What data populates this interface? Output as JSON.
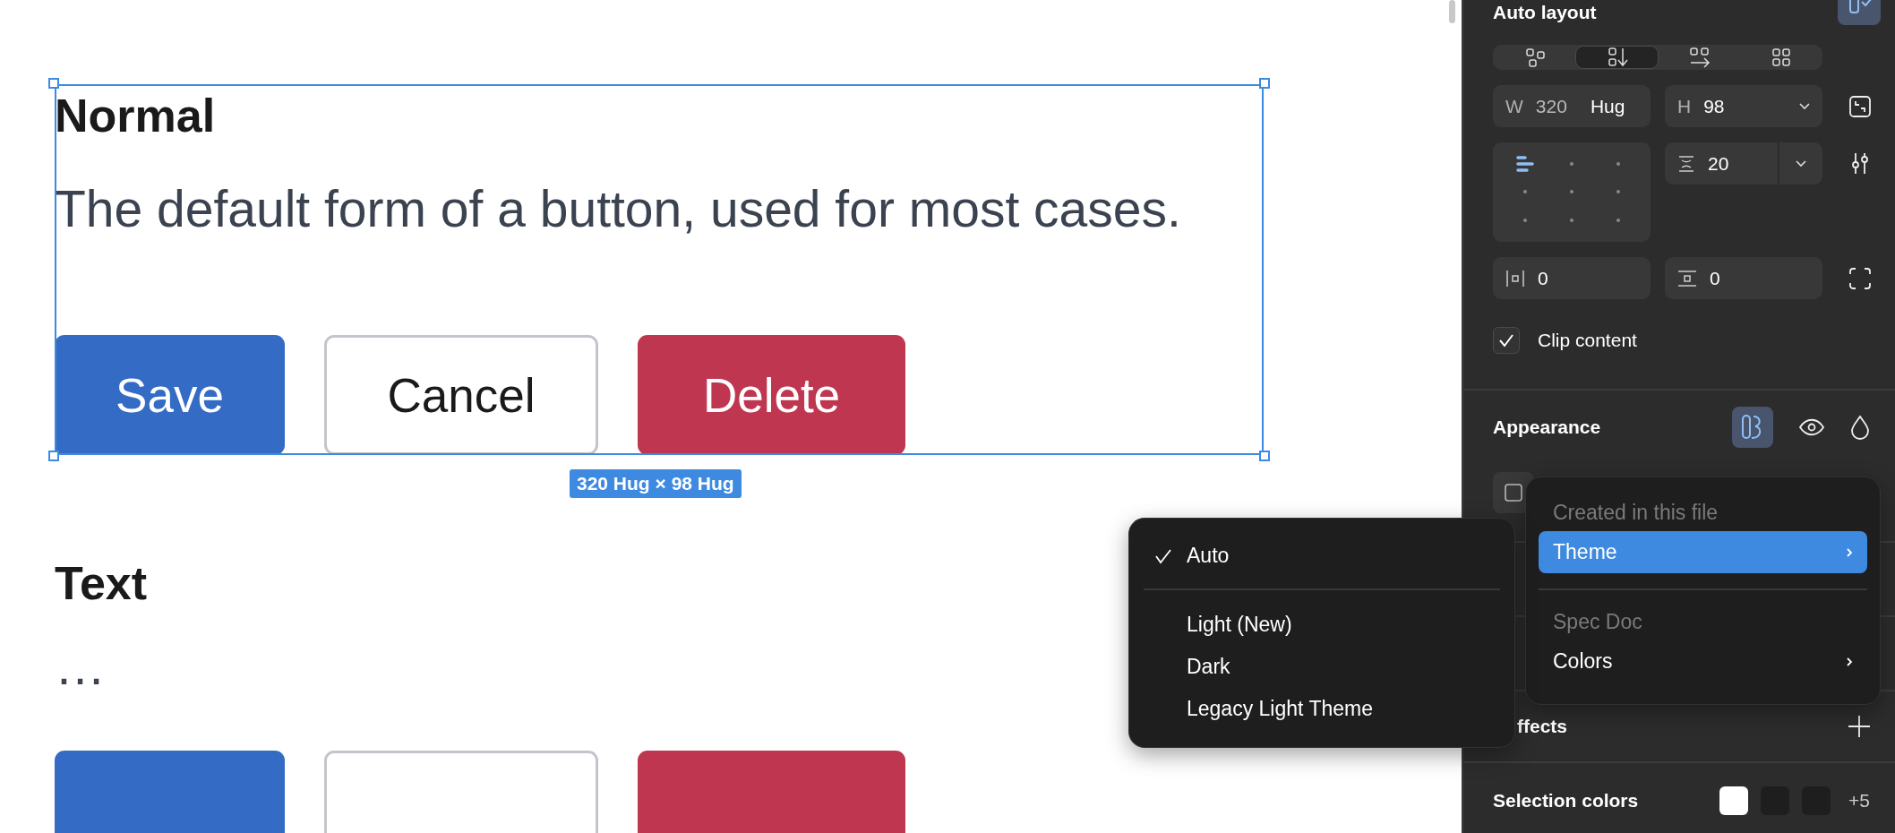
{
  "canvas": {
    "sections": [
      {
        "heading": "Normal",
        "description": "The default form of a button, used for most cases.",
        "selected": true,
        "size_label": "320 Hug × 98 Hug",
        "buttons": [
          {
            "label": "Save",
            "kind": "primary"
          },
          {
            "label": "Cancel",
            "kind": "secondary"
          },
          {
            "label": "Delete",
            "kind": "danger"
          }
        ]
      },
      {
        "heading": "Text",
        "description": "…",
        "selected": false,
        "buttons": [
          {
            "kind": "primary"
          },
          {
            "kind": "secondary"
          },
          {
            "kind": "danger"
          }
        ]
      }
    ]
  },
  "panel": {
    "auto_layout": {
      "title": "Auto layout",
      "directions": [
        {
          "kind": "free",
          "selected": false
        },
        {
          "kind": "vertical",
          "selected": true
        },
        {
          "kind": "horizontal",
          "selected": false
        },
        {
          "kind": "grid",
          "selected": false
        }
      ],
      "width": {
        "label": "W",
        "value": "320",
        "mode": "Hug"
      },
      "height": {
        "label": "H",
        "value": "98"
      },
      "alignment": [
        {
          "selected": true
        },
        {
          "selected": false
        },
        {
          "selected": false
        },
        {
          "selected": false
        },
        {
          "selected": false
        },
        {
          "selected": false
        },
        {
          "selected": false
        },
        {
          "selected": false
        },
        {
          "selected": false
        }
      ],
      "gap": {
        "value": "20"
      },
      "padding_horizontal": {
        "value": "0"
      },
      "padding_vertical": {
        "value": "0"
      },
      "clip_content": {
        "label": "Clip content",
        "checked": true
      }
    },
    "appearance": {
      "title": "Appearance"
    },
    "effects": {
      "title": "ffects"
    },
    "selection_colors": {
      "title": "Selection colors",
      "swatches": [
        {
          "color": "#ffffff"
        },
        {
          "color": "#1e1e1e"
        },
        {
          "color": "#1e1e1e"
        }
      ],
      "more": "+5"
    }
  },
  "library_menu": {
    "groups": [
      {
        "heading": "Created in this file",
        "items": [
          {
            "label": "Theme",
            "selected": true
          }
        ]
      },
      {
        "heading": "Spec Doc",
        "items": [
          {
            "label": "Colors",
            "selected": false
          }
        ]
      }
    ]
  },
  "mode_menu": {
    "items": [
      {
        "label": "Auto",
        "checked": true
      },
      {
        "label": "Light (New)",
        "checked": false
      },
      {
        "label": "Dark",
        "checked": false
      },
      {
        "label": "Legacy Light Theme",
        "checked": false
      }
    ]
  }
}
